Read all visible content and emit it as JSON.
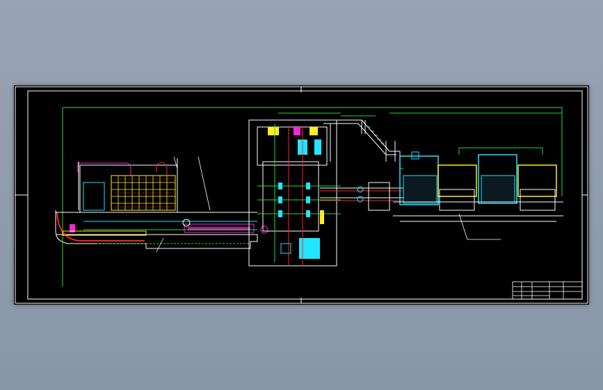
{
  "viewer": {
    "background_color": "#8a97a9"
  },
  "drawing": {
    "description": "",
    "colors": {
      "paper": "#000000",
      "frame": "#ffffff",
      "green": "#22dd33",
      "red": "#ff2222",
      "yellow": "#ffee22",
      "cyan": "#22e5ff",
      "magenta": "#ff22dd",
      "white": "#ffffff"
    },
    "title_block": {
      "cells": [
        "",
        "",
        "",
        "",
        "",
        "",
        "",
        ""
      ]
    }
  }
}
